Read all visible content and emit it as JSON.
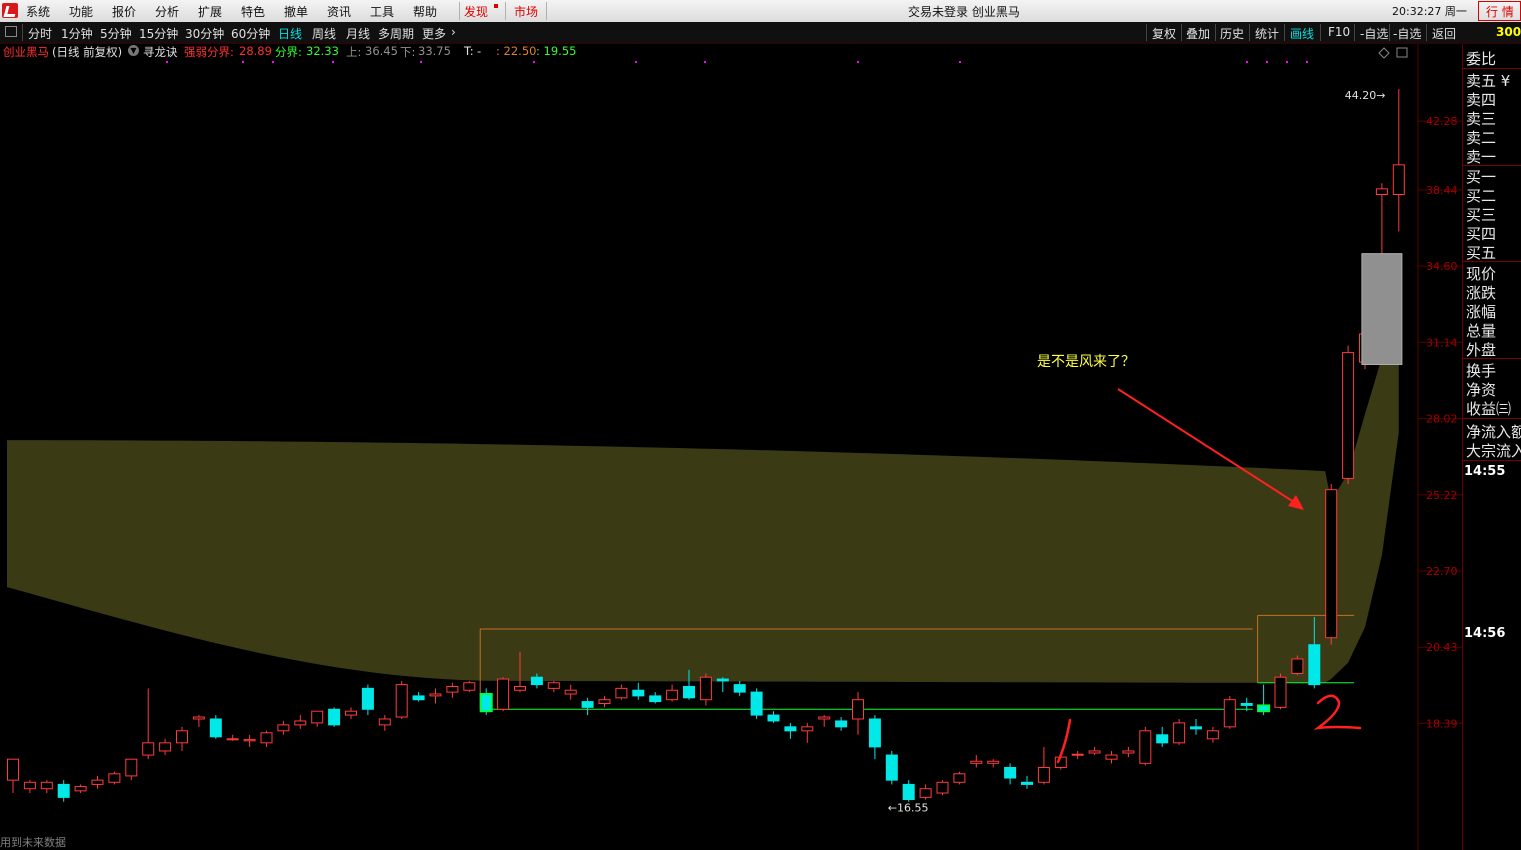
{
  "menu": {
    "items": [
      "系统",
      "功能",
      "报价",
      "分析",
      "扩展",
      "特色",
      "撤单",
      "资讯",
      "工具",
      "帮助"
    ],
    "faxian": "发现",
    "shichang": "市场",
    "center_title": "交易未登录  创业黑马",
    "time": "20:32:27 周一",
    "right_tab": "行 情"
  },
  "toolbar": {
    "periods": [
      "分时",
      "1分钟",
      "5分钟",
      "15分钟",
      "30分钟",
      "60分钟",
      "日线",
      "周线",
      "月线",
      "多周期",
      "更多"
    ],
    "active_period": "日线",
    "right_buttons": [
      "复权",
      "叠加",
      "历史",
      "统计",
      "画线",
      "F10",
      "-自选",
      "返回"
    ],
    "active_right": "画线",
    "code_fragment": "300"
  },
  "info": {
    "stock": "创业黑马",
    "mode": "(日线 前复权)",
    "indicator": "寻龙诀",
    "strong_weak_label": "强弱分界:",
    "strong_weak_value": "28.89",
    "split_label": "分界:",
    "split_value": "32.33",
    "up_label": "上:",
    "up_value": "36.45",
    "down_label": "下:",
    "down_value": "33.75",
    "t_label": "T:",
    "t_value": "-",
    "v1": ": 22.50",
    "v2": ": 19.55"
  },
  "colors": {
    "up": "#ff3b3b",
    "down": "#00e8e8",
    "band_fill": "#3a3a14",
    "axis_red": "#a00000",
    "green_line": "#00ff3a",
    "orange_line": "#c87020",
    "annotation": "#ffff40",
    "arrow": "#ff2020",
    "gray_box": "#909090"
  },
  "chart_data": {
    "type": "candlestick",
    "y_axis_ticks": [
      44.2,
      42.28,
      38.44,
      34.6,
      31.14,
      28.02,
      25.22,
      22.7,
      20.43,
      18.39
    ],
    "ylim": [
      16.0,
      45.5
    ],
    "y_scale": "log",
    "max_label": "44.20",
    "min_label": "16.55",
    "annotation": "是不是风来了？",
    "handwritten_marks": [
      "1",
      "2"
    ],
    "candles": [
      {
        "o": 17.0,
        "h": 17.5,
        "l": 16.7,
        "c": 17.5
      },
      {
        "o": 16.8,
        "h": 17.0,
        "l": 16.7,
        "c": 16.95
      },
      {
        "o": 16.8,
        "h": 17.0,
        "l": 16.7,
        "c": 16.95
      },
      {
        "o": 16.9,
        "h": 17.0,
        "l": 16.5,
        "c": 16.6
      },
      {
        "o": 16.75,
        "h": 16.9,
        "l": 16.7,
        "c": 16.85
      },
      {
        "o": 16.9,
        "h": 17.1,
        "l": 16.8,
        "c": 17.0
      },
      {
        "o": 16.95,
        "h": 17.2,
        "l": 16.9,
        "c": 17.15
      },
      {
        "o": 17.1,
        "h": 17.5,
        "l": 17.0,
        "c": 17.5
      },
      {
        "o": 17.6,
        "h": 19.3,
        "l": 17.5,
        "c": 17.9
      },
      {
        "o": 17.7,
        "h": 18.0,
        "l": 17.6,
        "c": 17.9
      },
      {
        "o": 17.9,
        "h": 18.3,
        "l": 17.7,
        "c": 18.2
      },
      {
        "o": 18.5,
        "h": 18.6,
        "l": 18.3,
        "c": 18.55
      },
      {
        "o": 18.5,
        "h": 18.6,
        "l": 18.0,
        "c": 18.05
      },
      {
        "o": 18.0,
        "h": 18.1,
        "l": 17.95,
        "c": 18.0
      },
      {
        "o": 17.95,
        "h": 18.1,
        "l": 17.8,
        "c": 17.98
      },
      {
        "o": 17.9,
        "h": 18.2,
        "l": 17.8,
        "c": 18.15
      },
      {
        "o": 18.2,
        "h": 18.45,
        "l": 18.1,
        "c": 18.35
      },
      {
        "o": 18.35,
        "h": 18.6,
        "l": 18.25,
        "c": 18.45
      },
      {
        "o": 18.4,
        "h": 18.65,
        "l": 18.3,
        "c": 18.7
      },
      {
        "o": 18.75,
        "h": 18.8,
        "l": 18.3,
        "c": 18.35
      },
      {
        "o": 18.6,
        "h": 18.8,
        "l": 18.5,
        "c": 18.7
      },
      {
        "o": 19.3,
        "h": 19.4,
        "l": 18.6,
        "c": 18.75
      },
      {
        "o": 18.35,
        "h": 18.6,
        "l": 18.2,
        "c": 18.5
      },
      {
        "o": 18.55,
        "h": 19.5,
        "l": 18.5,
        "c": 19.4
      },
      {
        "o": 19.1,
        "h": 19.2,
        "l": 18.95,
        "c": 19.0
      },
      {
        "o": 19.1,
        "h": 19.3,
        "l": 18.9,
        "c": 19.15
      },
      {
        "o": 19.2,
        "h": 19.45,
        "l": 19.05,
        "c": 19.35
      },
      {
        "o": 19.25,
        "h": 19.5,
        "l": 19.2,
        "c": 19.45
      },
      {
        "o": 19.15,
        "h": 19.3,
        "l": 18.6,
        "c": 18.7
      },
      {
        "o": 18.75,
        "h": 19.6,
        "l": 18.7,
        "c": 19.55
      },
      {
        "o": 19.25,
        "h": 20.3,
        "l": 19.2,
        "c": 19.35
      },
      {
        "o": 19.6,
        "h": 19.7,
        "l": 19.3,
        "c": 19.4
      },
      {
        "o": 19.3,
        "h": 19.5,
        "l": 19.2,
        "c": 19.45
      },
      {
        "o": 19.15,
        "h": 19.4,
        "l": 19.0,
        "c": 19.25
      },
      {
        "o": 18.95,
        "h": 19.05,
        "l": 18.6,
        "c": 18.8
      },
      {
        "o": 18.9,
        "h": 19.1,
        "l": 18.8,
        "c": 19.0
      },
      {
        "o": 19.05,
        "h": 19.4,
        "l": 19.0,
        "c": 19.3
      },
      {
        "o": 19.25,
        "h": 19.45,
        "l": 19.0,
        "c": 19.1
      },
      {
        "o": 19.1,
        "h": 19.2,
        "l": 18.9,
        "c": 18.95
      },
      {
        "o": 19.0,
        "h": 19.4,
        "l": 18.95,
        "c": 19.25
      },
      {
        "o": 19.35,
        "h": 19.8,
        "l": 19.0,
        "c": 19.05
      },
      {
        "o": 19.0,
        "h": 19.7,
        "l": 18.85,
        "c": 19.6
      },
      {
        "o": 19.55,
        "h": 19.6,
        "l": 19.2,
        "c": 19.5
      },
      {
        "o": 19.4,
        "h": 19.5,
        "l": 19.1,
        "c": 19.2
      },
      {
        "o": 19.2,
        "h": 19.3,
        "l": 18.5,
        "c": 18.6
      },
      {
        "o": 18.6,
        "h": 18.7,
        "l": 18.4,
        "c": 18.45
      },
      {
        "o": 18.3,
        "h": 18.4,
        "l": 18.0,
        "c": 18.2
      },
      {
        "o": 18.2,
        "h": 18.4,
        "l": 17.9,
        "c": 18.3
      },
      {
        "o": 18.5,
        "h": 18.6,
        "l": 18.3,
        "c": 18.55
      },
      {
        "o": 18.45,
        "h": 18.55,
        "l": 18.2,
        "c": 18.3
      },
      {
        "o": 18.5,
        "h": 19.2,
        "l": 18.1,
        "c": 19.0
      },
      {
        "o": 18.5,
        "h": 18.6,
        "l": 17.5,
        "c": 17.8
      },
      {
        "o": 17.6,
        "h": 17.7,
        "l": 16.9,
        "c": 17.0
      },
      {
        "o": 16.9,
        "h": 17.0,
        "l": 16.5,
        "c": 16.55
      },
      {
        "o": 16.6,
        "h": 16.9,
        "l": 16.55,
        "c": 16.8
      },
      {
        "o": 16.7,
        "h": 17.0,
        "l": 16.65,
        "c": 16.95
      },
      {
        "o": 16.95,
        "h": 17.2,
        "l": 16.9,
        "c": 17.15
      },
      {
        "o": 17.4,
        "h": 17.6,
        "l": 17.3,
        "c": 17.45
      },
      {
        "o": 17.4,
        "h": 17.5,
        "l": 17.3,
        "c": 17.45
      },
      {
        "o": 17.3,
        "h": 17.4,
        "l": 16.9,
        "c": 17.05
      },
      {
        "o": 16.95,
        "h": 17.1,
        "l": 16.8,
        "c": 16.9
      },
      {
        "o": 16.95,
        "h": 17.8,
        "l": 16.9,
        "c": 17.3
      },
      {
        "o": 17.3,
        "h": 17.6,
        "l": 17.25,
        "c": 17.55
      },
      {
        "o": 17.6,
        "h": 17.7,
        "l": 17.5,
        "c": 17.62
      },
      {
        "o": 17.65,
        "h": 17.8,
        "l": 17.6,
        "c": 17.7
      },
      {
        "o": 17.5,
        "h": 17.7,
        "l": 17.4,
        "c": 17.6
      },
      {
        "o": 17.65,
        "h": 17.8,
        "l": 17.55,
        "c": 17.7
      },
      {
        "o": 17.4,
        "h": 18.3,
        "l": 17.35,
        "c": 18.2
      },
      {
        "o": 18.1,
        "h": 18.3,
        "l": 17.8,
        "c": 17.9
      },
      {
        "o": 17.9,
        "h": 18.5,
        "l": 17.85,
        "c": 18.4
      },
      {
        "o": 18.3,
        "h": 18.5,
        "l": 18.1,
        "c": 18.25
      },
      {
        "o": 18.0,
        "h": 18.3,
        "l": 17.9,
        "c": 18.2
      },
      {
        "o": 18.3,
        "h": 19.1,
        "l": 18.25,
        "c": 19.0
      },
      {
        "o": 18.9,
        "h": 19.05,
        "l": 18.7,
        "c": 18.85
      },
      {
        "o": 18.85,
        "h": 19.4,
        "l": 18.6,
        "c": 18.7
      },
      {
        "o": 18.8,
        "h": 19.7,
        "l": 18.75,
        "c": 19.6
      },
      {
        "o": 19.7,
        "h": 20.2,
        "l": 19.65,
        "c": 20.1
      },
      {
        "o": 20.5,
        "h": 21.3,
        "l": 19.3,
        "c": 19.4
      },
      {
        "o": 20.7,
        "h": 25.6,
        "l": 20.5,
        "c": 25.4
      },
      {
        "o": 25.8,
        "h": 31.0,
        "l": 25.6,
        "c": 30.7
      },
      {
        "o": 30.3,
        "h": 34.0,
        "l": 30.0,
        "c": 31.5
      },
      {
        "o": 38.2,
        "h": 38.8,
        "l": 35.2,
        "c": 38.5
      },
      {
        "o": 38.2,
        "h": 44.2,
        "l": 36.3,
        "c": 39.8
      }
    ]
  }
}
